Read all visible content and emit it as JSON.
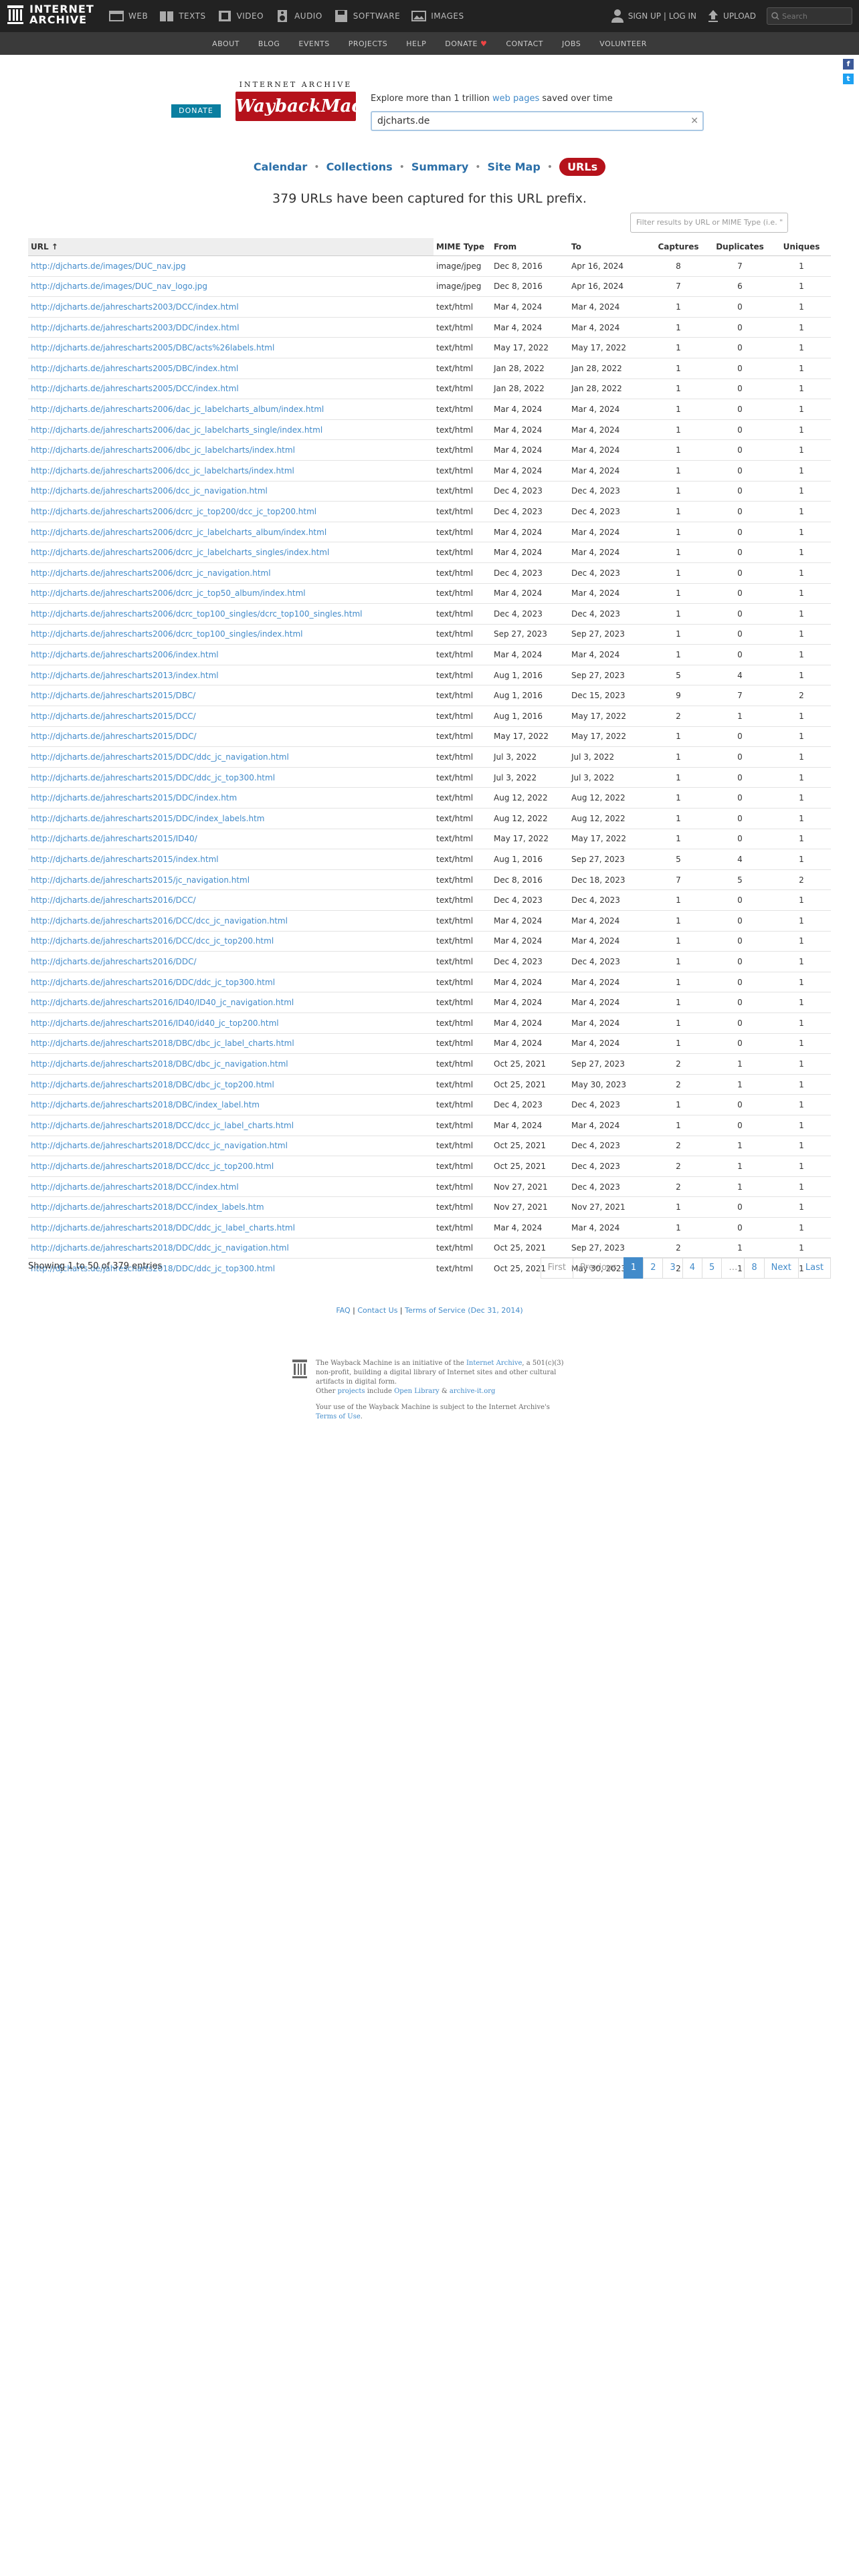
{
  "topbar": {
    "logo_line1": "INTERNET",
    "logo_line2": "ARCHIVE",
    "nav": [
      {
        "label": "WEB",
        "icon": "web-icon"
      },
      {
        "label": "TEXTS",
        "icon": "book-icon"
      },
      {
        "label": "VIDEO",
        "icon": "film-icon"
      },
      {
        "label": "AUDIO",
        "icon": "speaker-icon"
      },
      {
        "label": "SOFTWARE",
        "icon": "floppy-icon"
      },
      {
        "label": "IMAGES",
        "icon": "image-icon"
      }
    ],
    "signup": "SIGN UP | LOG IN",
    "upload": "UPLOAD",
    "search_placeholder": "Search"
  },
  "subnav": [
    "ABOUT",
    "BLOG",
    "EVENTS",
    "PROJECTS",
    "HELP",
    "DONATE",
    "CONTACT",
    "JOBS",
    "VOLUNTEER"
  ],
  "wayback": {
    "donate": "DONATE",
    "logo_top": "INTERNET ARCHIVE",
    "logo_main": "WaybackMachine",
    "explore_pre": "Explore more than 1 trillion ",
    "explore_link": "web pages",
    "explore_post": " saved over time",
    "url_value": "djcharts.de"
  },
  "tabs": [
    "Calendar",
    "Collections",
    "Summary",
    "Site Map",
    "URLs"
  ],
  "summary": "379 URLs have been captured for this URL prefix.",
  "filter_placeholder": "Filter results by URL or MIME Type (i.e. \"",
  "table": {
    "headers": [
      "URL ↑",
      "MIME Type",
      "From",
      "To",
      "Captures",
      "Duplicates",
      "Uniques"
    ],
    "rows": [
      [
        "http://djcharts.de/images/DUC_nav.jpg",
        "image/jpeg",
        "Dec 8, 2016",
        "Apr 16, 2024",
        "8",
        "7",
        "1"
      ],
      [
        "http://djcharts.de/images/DUC_nav_logo.jpg",
        "image/jpeg",
        "Dec 8, 2016",
        "Apr 16, 2024",
        "7",
        "6",
        "1"
      ],
      [
        "http://djcharts.de/jahrescharts2003/DCC/index.html",
        "text/html",
        "Mar 4, 2024",
        "Mar 4, 2024",
        "1",
        "0",
        "1"
      ],
      [
        "http://djcharts.de/jahrescharts2003/DDC/index.html",
        "text/html",
        "Mar 4, 2024",
        "Mar 4, 2024",
        "1",
        "0",
        "1"
      ],
      [
        "http://djcharts.de/jahrescharts2005/DBC/acts%26labels.html",
        "text/html",
        "May 17, 2022",
        "May 17, 2022",
        "1",
        "0",
        "1"
      ],
      [
        "http://djcharts.de/jahrescharts2005/DBC/index.html",
        "text/html",
        "Jan 28, 2022",
        "Jan 28, 2022",
        "1",
        "0",
        "1"
      ],
      [
        "http://djcharts.de/jahrescharts2005/DCC/index.html",
        "text/html",
        "Jan 28, 2022",
        "Jan 28, 2022",
        "1",
        "0",
        "1"
      ],
      [
        "http://djcharts.de/jahrescharts2006/dac_jc_labelcharts_album/index.html",
        "text/html",
        "Mar 4, 2024",
        "Mar 4, 2024",
        "1",
        "0",
        "1"
      ],
      [
        "http://djcharts.de/jahrescharts2006/dac_jc_labelcharts_single/index.html",
        "text/html",
        "Mar 4, 2024",
        "Mar 4, 2024",
        "1",
        "0",
        "1"
      ],
      [
        "http://djcharts.de/jahrescharts2006/dbc_jc_labelcharts/index.html",
        "text/html",
        "Mar 4, 2024",
        "Mar 4, 2024",
        "1",
        "0",
        "1"
      ],
      [
        "http://djcharts.de/jahrescharts2006/dcc_jc_labelcharts/index.html",
        "text/html",
        "Mar 4, 2024",
        "Mar 4, 2024",
        "1",
        "0",
        "1"
      ],
      [
        "http://djcharts.de/jahrescharts2006/dcc_jc_navigation.html",
        "text/html",
        "Dec 4, 2023",
        "Dec 4, 2023",
        "1",
        "0",
        "1"
      ],
      [
        "http://djcharts.de/jahrescharts2006/dcrc_jc_top200/dcc_jc_top200.html",
        "text/html",
        "Dec 4, 2023",
        "Dec 4, 2023",
        "1",
        "0",
        "1"
      ],
      [
        "http://djcharts.de/jahrescharts2006/dcrc_jc_labelcharts_album/index.html",
        "text/html",
        "Mar 4, 2024",
        "Mar 4, 2024",
        "1",
        "0",
        "1"
      ],
      [
        "http://djcharts.de/jahrescharts2006/dcrc_jc_labelcharts_singles/index.html",
        "text/html",
        "Mar 4, 2024",
        "Mar 4, 2024",
        "1",
        "0",
        "1"
      ],
      [
        "http://djcharts.de/jahrescharts2006/dcrc_jc_navigation.html",
        "text/html",
        "Dec 4, 2023",
        "Dec 4, 2023",
        "1",
        "0",
        "1"
      ],
      [
        "http://djcharts.de/jahrescharts2006/dcrc_jc_top50_album/index.html",
        "text/html",
        "Mar 4, 2024",
        "Mar 4, 2024",
        "1",
        "0",
        "1"
      ],
      [
        "http://djcharts.de/jahrescharts2006/dcrc_top100_singles/dcrc_top100_singles.html",
        "text/html",
        "Dec 4, 2023",
        "Dec 4, 2023",
        "1",
        "0",
        "1"
      ],
      [
        "http://djcharts.de/jahrescharts2006/dcrc_top100_singles/index.html",
        "text/html",
        "Sep 27, 2023",
        "Sep 27, 2023",
        "1",
        "0",
        "1"
      ],
      [
        "http://djcharts.de/jahrescharts2006/index.html",
        "text/html",
        "Mar 4, 2024",
        "Mar 4, 2024",
        "1",
        "0",
        "1"
      ],
      [
        "http://djcharts.de/jahrescharts2013/index.html",
        "text/html",
        "Aug 1, 2016",
        "Sep 27, 2023",
        "5",
        "4",
        "1"
      ],
      [
        "http://djcharts.de/jahrescharts2015/DBC/",
        "text/html",
        "Aug 1, 2016",
        "Dec 15, 2023",
        "9",
        "7",
        "2"
      ],
      [
        "http://djcharts.de/jahrescharts2015/DCC/",
        "text/html",
        "Aug 1, 2016",
        "May 17, 2022",
        "2",
        "1",
        "1"
      ],
      [
        "http://djcharts.de/jahrescharts2015/DDC/",
        "text/html",
        "May 17, 2022",
        "May 17, 2022",
        "1",
        "0",
        "1"
      ],
      [
        "http://djcharts.de/jahrescharts2015/DDC/ddc_jc_navigation.html",
        "text/html",
        "Jul 3, 2022",
        "Jul 3, 2022",
        "1",
        "0",
        "1"
      ],
      [
        "http://djcharts.de/jahrescharts2015/DDC/ddc_jc_top300.html",
        "text/html",
        "Jul 3, 2022",
        "Jul 3, 2022",
        "1",
        "0",
        "1"
      ],
      [
        "http://djcharts.de/jahrescharts2015/DDC/index.htm",
        "text/html",
        "Aug 12, 2022",
        "Aug 12, 2022",
        "1",
        "0",
        "1"
      ],
      [
        "http://djcharts.de/jahrescharts2015/DDC/index_labels.htm",
        "text/html",
        "Aug 12, 2022",
        "Aug 12, 2022",
        "1",
        "0",
        "1"
      ],
      [
        "http://djcharts.de/jahrescharts2015/ID40/",
        "text/html",
        "May 17, 2022",
        "May 17, 2022",
        "1",
        "0",
        "1"
      ],
      [
        "http://djcharts.de/jahrescharts2015/index.html",
        "text/html",
        "Aug 1, 2016",
        "Sep 27, 2023",
        "5",
        "4",
        "1"
      ],
      [
        "http://djcharts.de/jahrescharts2015/jc_navigation.html",
        "text/html",
        "Dec 8, 2016",
        "Dec 18, 2023",
        "7",
        "5",
        "2"
      ],
      [
        "http://djcharts.de/jahrescharts2016/DCC/",
        "text/html",
        "Dec 4, 2023",
        "Dec 4, 2023",
        "1",
        "0",
        "1"
      ],
      [
        "http://djcharts.de/jahrescharts2016/DCC/dcc_jc_navigation.html",
        "text/html",
        "Mar 4, 2024",
        "Mar 4, 2024",
        "1",
        "0",
        "1"
      ],
      [
        "http://djcharts.de/jahrescharts2016/DCC/dcc_jc_top200.html",
        "text/html",
        "Mar 4, 2024",
        "Mar 4, 2024",
        "1",
        "0",
        "1"
      ],
      [
        "http://djcharts.de/jahrescharts2016/DDC/",
        "text/html",
        "Dec 4, 2023",
        "Dec 4, 2023",
        "1",
        "0",
        "1"
      ],
      [
        "http://djcharts.de/jahrescharts2016/DDC/ddc_jc_top300.html",
        "text/html",
        "Mar 4, 2024",
        "Mar 4, 2024",
        "1",
        "0",
        "1"
      ],
      [
        "http://djcharts.de/jahrescharts2016/ID40/ID40_jc_navigation.html",
        "text/html",
        "Mar 4, 2024",
        "Mar 4, 2024",
        "1",
        "0",
        "1"
      ],
      [
        "http://djcharts.de/jahrescharts2016/ID40/id40_jc_top200.html",
        "text/html",
        "Mar 4, 2024",
        "Mar 4, 2024",
        "1",
        "0",
        "1"
      ],
      [
        "http://djcharts.de/jahrescharts2018/DBC/dbc_jc_label_charts.html",
        "text/html",
        "Mar 4, 2024",
        "Mar 4, 2024",
        "1",
        "0",
        "1"
      ],
      [
        "http://djcharts.de/jahrescharts2018/DBC/dbc_jc_navigation.html",
        "text/html",
        "Oct 25, 2021",
        "Sep 27, 2023",
        "2",
        "1",
        "1"
      ],
      [
        "http://djcharts.de/jahrescharts2018/DBC/dbc_jc_top200.html",
        "text/html",
        "Oct 25, 2021",
        "May 30, 2023",
        "2",
        "1",
        "1"
      ],
      [
        "http://djcharts.de/jahrescharts2018/DBC/index_label.htm",
        "text/html",
        "Dec 4, 2023",
        "Dec 4, 2023",
        "1",
        "0",
        "1"
      ],
      [
        "http://djcharts.de/jahrescharts2018/DCC/dcc_jc_label_charts.html",
        "text/html",
        "Mar 4, 2024",
        "Mar 4, 2024",
        "1",
        "0",
        "1"
      ],
      [
        "http://djcharts.de/jahrescharts2018/DCC/dcc_jc_navigation.html",
        "text/html",
        "Oct 25, 2021",
        "Dec 4, 2023",
        "2",
        "1",
        "1"
      ],
      [
        "http://djcharts.de/jahrescharts2018/DCC/dcc_jc_top200.html",
        "text/html",
        "Oct 25, 2021",
        "Dec 4, 2023",
        "2",
        "1",
        "1"
      ],
      [
        "http://djcharts.de/jahrescharts2018/DCC/index.html",
        "text/html",
        "Nov 27, 2021",
        "Dec 4, 2023",
        "2",
        "1",
        "1"
      ],
      [
        "http://djcharts.de/jahrescharts2018/DCC/index_labels.htm",
        "text/html",
        "Nov 27, 2021",
        "Nov 27, 2021",
        "1",
        "0",
        "1"
      ],
      [
        "http://djcharts.de/jahrescharts2018/DDC/ddc_jc_label_charts.html",
        "text/html",
        "Mar 4, 2024",
        "Mar 4, 2024",
        "1",
        "0",
        "1"
      ],
      [
        "http://djcharts.de/jahrescharts2018/DDC/ddc_jc_navigation.html",
        "text/html",
        "Oct 25, 2021",
        "Sep 27, 2023",
        "2",
        "1",
        "1"
      ],
      [
        "http://djcharts.de/jahrescharts2018/DDC/ddc_jc_top300.html",
        "text/html",
        "Oct 25, 2021",
        "May 30, 2023",
        "2",
        "1",
        "1"
      ]
    ]
  },
  "entries": "Showing 1 to 50 of 379 entries",
  "pager": [
    "First",
    "Previous",
    "1",
    "2",
    "3",
    "4",
    "5",
    "…",
    "8",
    "Next",
    "Last"
  ],
  "footer_links": "FAQ | Contact Us | Terms of Service (Dec 31, 2014)",
  "about": {
    "p1_a": "The Wayback Machine is an initiative of the ",
    "p1_link": "Internet Archive",
    "p1_b": ", a 501(c)(3) non-profit, building a digital library of Internet sites and other cultural artifacts in digital form.",
    "p2_a": "Other ",
    "p2_link1": "projects",
    "p2_b": " include ",
    "p2_link2": "Open Library",
    "p2_c": " & ",
    "p2_link3": "archive-it.org",
    "p3_a": "Your use of the Wayback Machine is subject to the Internet Archive's ",
    "p3_link": "Terms of Use",
    "p3_b": "."
  },
  "colors": {
    "accent_red": "#b5121b",
    "link_blue": "#428bca",
    "donate_teal": "#0a7ea0"
  }
}
